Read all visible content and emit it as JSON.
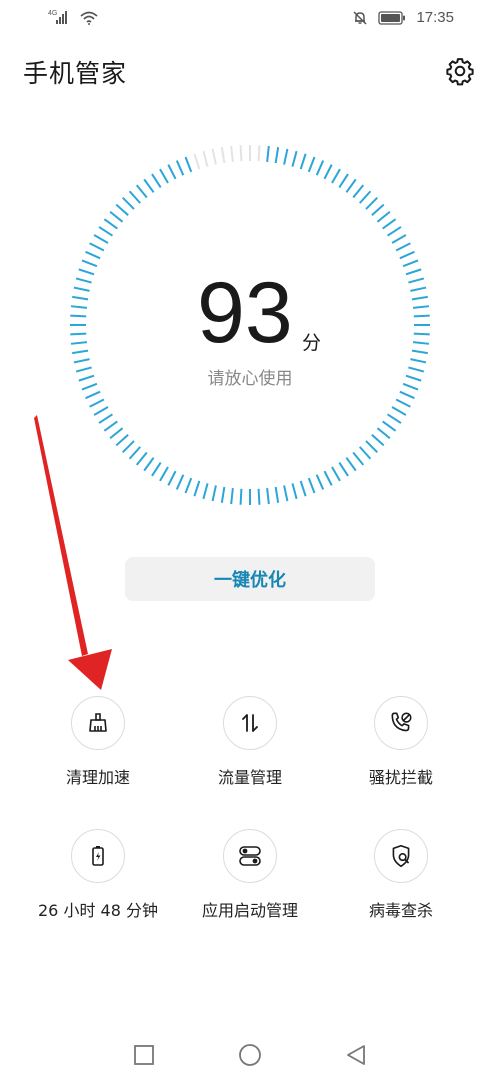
{
  "status_bar": {
    "network_label": "4G",
    "time": "17:35",
    "icons": [
      "signal-icon",
      "wifi-icon",
      "mute-bell-icon",
      "battery-icon"
    ]
  },
  "header": {
    "title": "手机管家",
    "settings_icon": "gear-icon"
  },
  "score": {
    "value": "93",
    "unit": "分",
    "status": "请放心使用",
    "gauge_fraction": 0.93,
    "accent_color": "#2aa6d8"
  },
  "optimize_button": {
    "label": "一键优化",
    "color": "#1786b4"
  },
  "tools": [
    {
      "label": "清理加速",
      "icon": "broom-icon"
    },
    {
      "label": "流量管理",
      "icon": "data-transfer-icon"
    },
    {
      "label": "骚扰拦截",
      "icon": "phone-block-icon"
    },
    {
      "label": "26 小时 48 分钟",
      "icon": "battery-charge-icon"
    },
    {
      "label": "应用启动管理",
      "icon": "toggle-switches-icon"
    },
    {
      "label": "病毒查杀",
      "icon": "shield-search-icon"
    }
  ],
  "annotation": {
    "arrow_color": "#e02424"
  },
  "nav_bar": {
    "icons": [
      "recent-apps-icon",
      "home-icon",
      "back-icon"
    ]
  }
}
